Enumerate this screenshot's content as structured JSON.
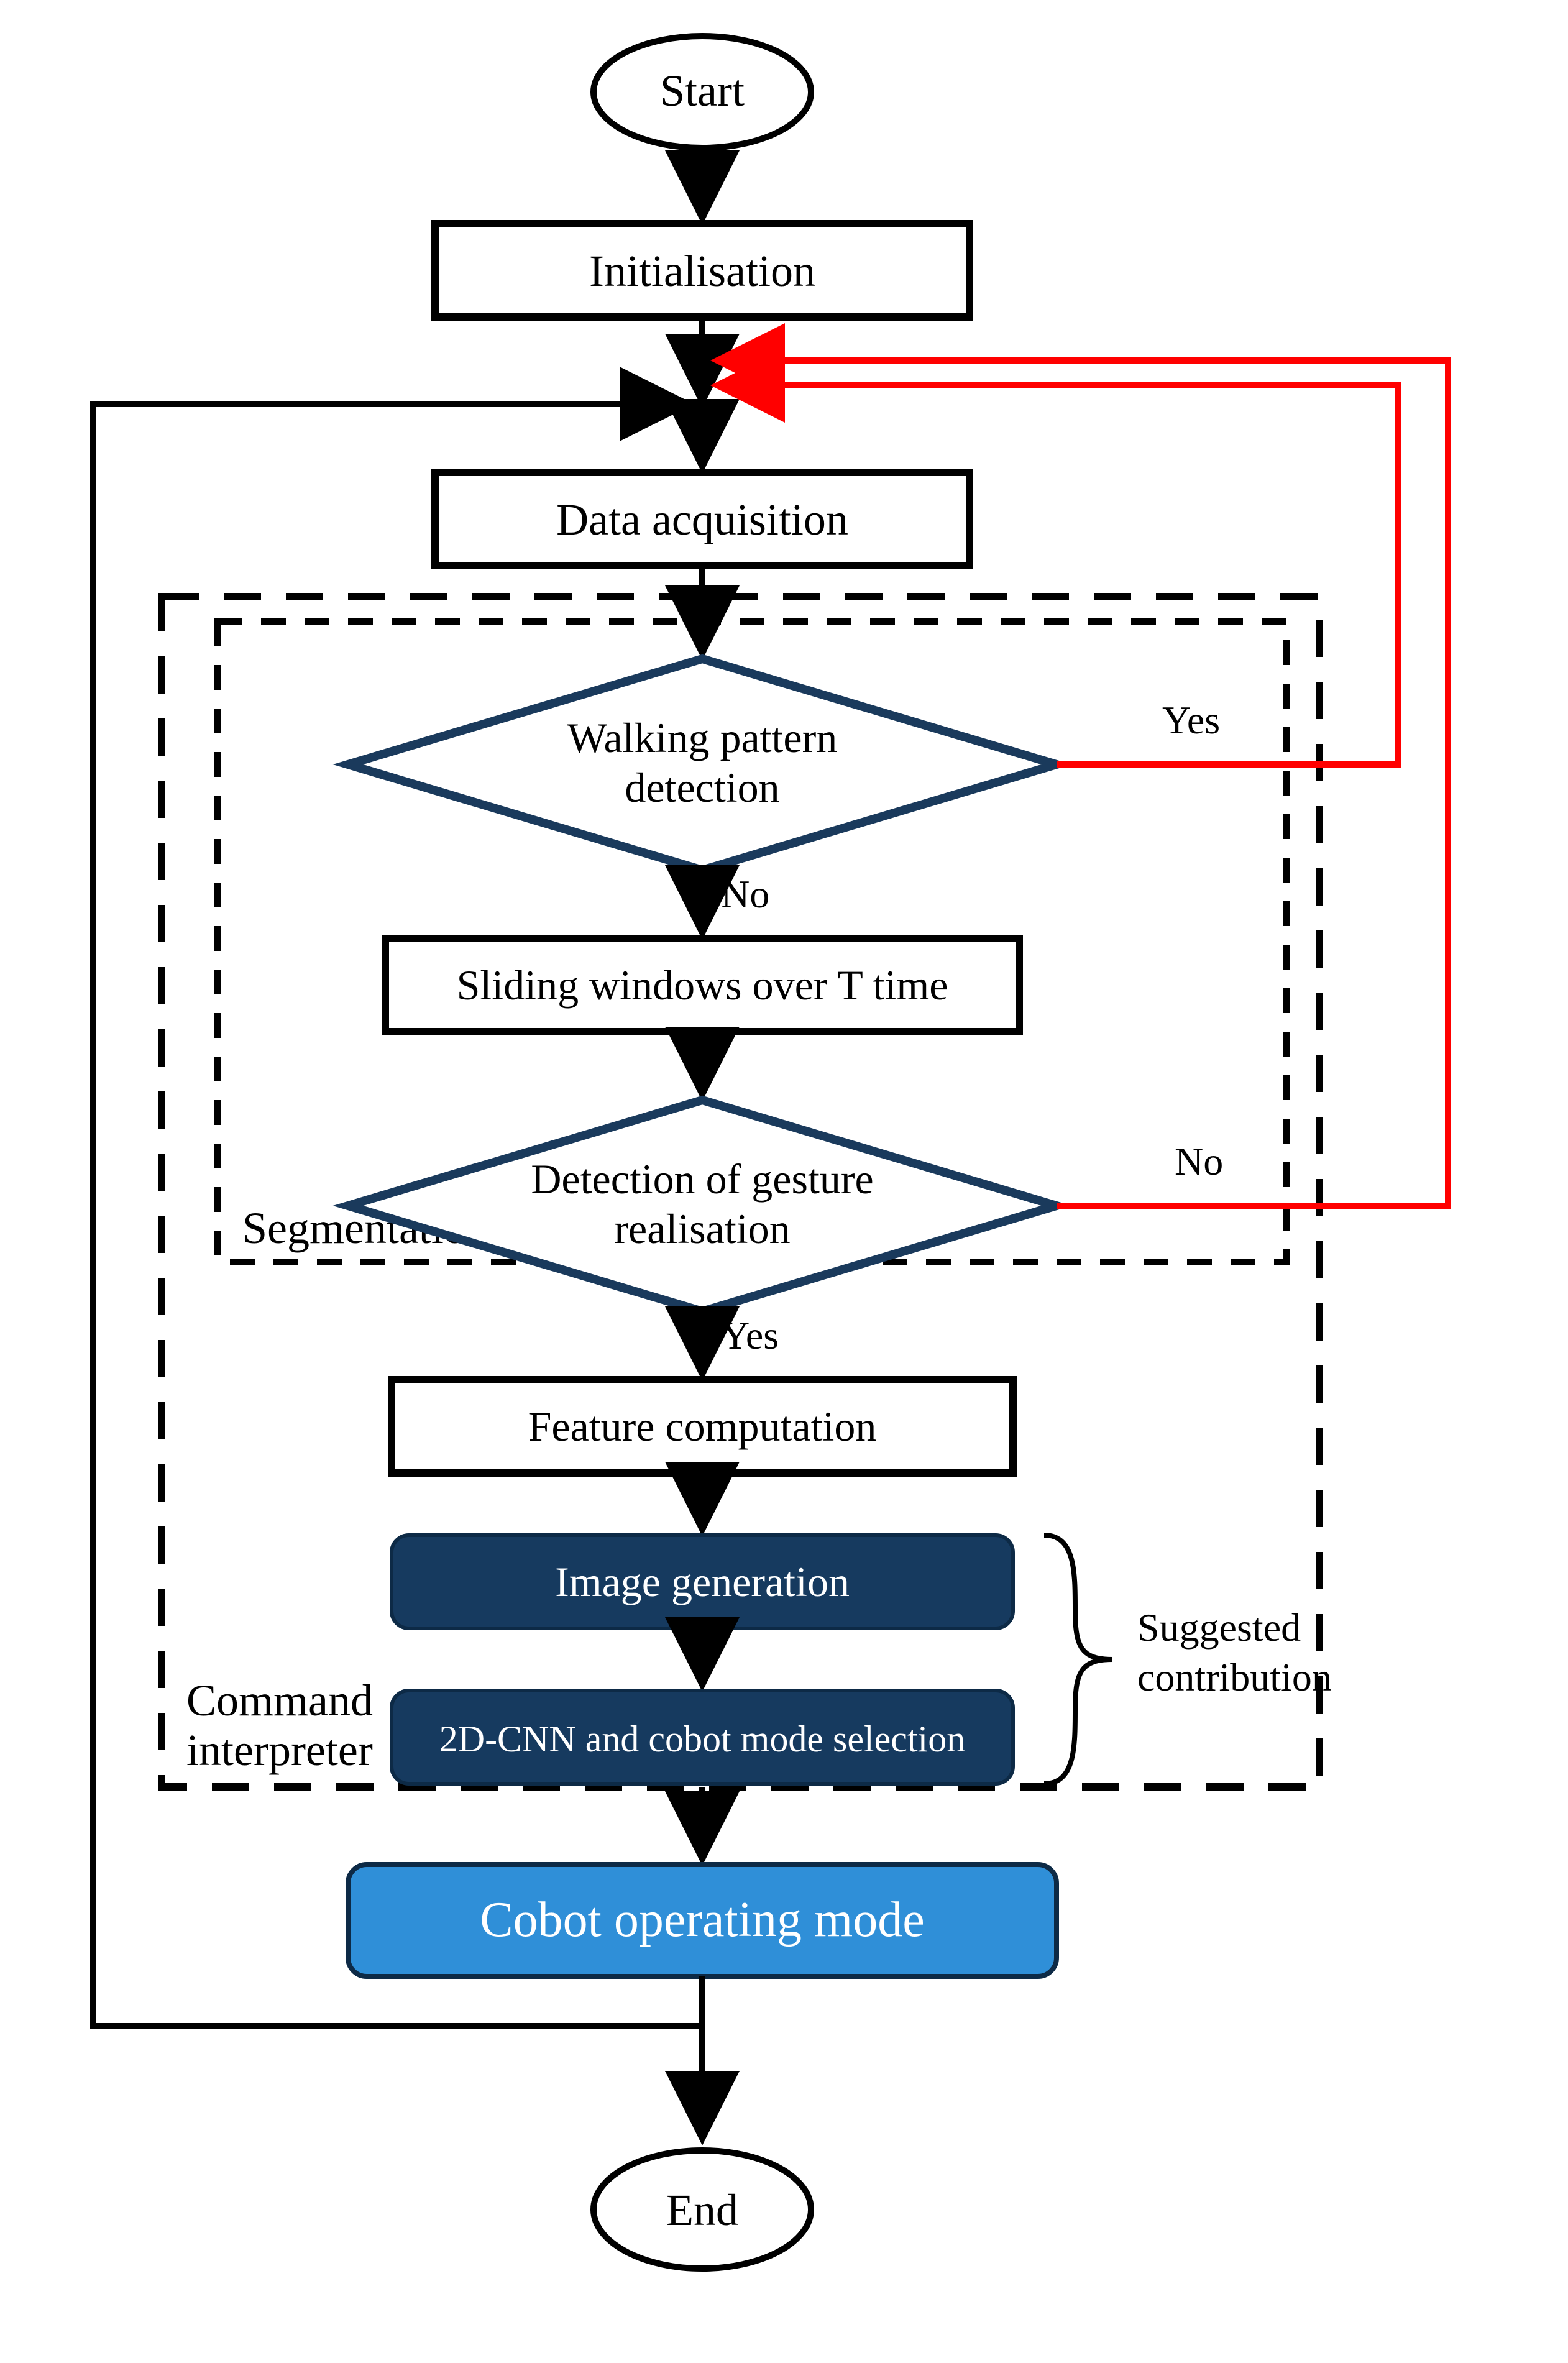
{
  "nodes": {
    "start": "Start",
    "init": "Initialisation",
    "data_acq": "Data acquisition",
    "walk_det": "Walking pattern detection",
    "sliding": "Sliding windows over T time",
    "gesture_det_l1": "Detection of gesture",
    "gesture_det_l2": "realisation",
    "feature": "Feature computation",
    "img_gen": "Image generation",
    "cnn": "2D-CNN and cobot mode selection",
    "cobot": "Cobot operating mode",
    "end": "End"
  },
  "groups": {
    "segmentation": "Segmentation",
    "command_l1": "Command",
    "command_l2": "interpreter"
  },
  "edge_labels": {
    "walk_yes": "Yes",
    "walk_no": "No",
    "gesture_no": "No",
    "gesture_yes": "Yes"
  },
  "annotation": {
    "contrib_l1": "Suggested",
    "contrib_l2": "contribution"
  },
  "colors": {
    "black": "#000000",
    "darkblue": "#1a3a5c",
    "fillDark": "#163a5f",
    "brightBlue": "#2f8fd8",
    "red": "#ff0000"
  }
}
